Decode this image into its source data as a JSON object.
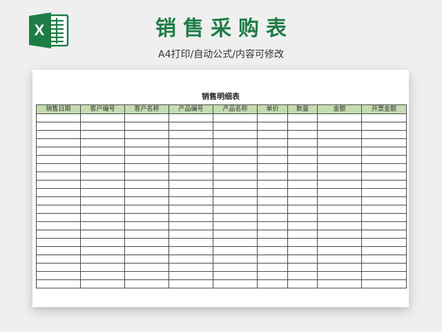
{
  "header": {
    "logo_letter": "X",
    "title": "销售采购表",
    "subtitle": "A4打印/自动公式/内容可修改"
  },
  "sheet": {
    "title": "销售明细表",
    "columns": [
      "销售日期",
      "客户编号",
      "客户名称",
      "产品编号",
      "产品名称",
      "单价",
      "数量",
      "金额",
      "开票金额"
    ],
    "empty_row_count": 21
  },
  "colors": {
    "brand_green": "#1e7d46",
    "header_fill": "#c4dcb0",
    "background": "#efefef",
    "grid_line": "#4a4a4a"
  }
}
